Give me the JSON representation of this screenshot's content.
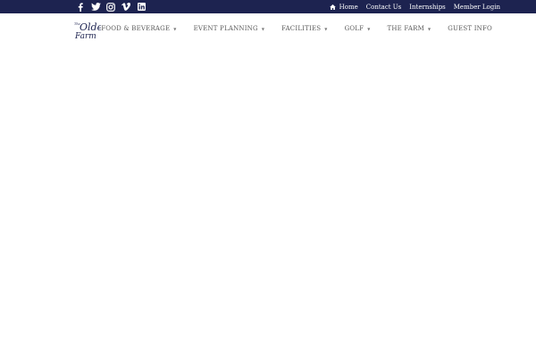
{
  "topbar": {
    "background": "#1d2350",
    "social": [
      {
        "icon": "facebook-icon"
      },
      {
        "icon": "twitter-icon"
      },
      {
        "icon": "instagram-icon"
      },
      {
        "icon": "vimeo-icon"
      },
      {
        "icon": "linkedin-icon"
      }
    ],
    "links": {
      "home": "Home",
      "contact": "Contact Us",
      "internships": "Internships",
      "member_login": "Member Login"
    }
  },
  "header": {
    "logo_text": "The Olde Farm",
    "nav": {
      "food_beverage": "FOOD & BEVERAGE",
      "event_planning": "EVENT PLANNING",
      "facilities": "FACILITIES",
      "golf": "GOLF",
      "the_farm": "THE FARM",
      "guest_info": "GUEST INFO"
    },
    "dropdown_caret": "▼"
  }
}
